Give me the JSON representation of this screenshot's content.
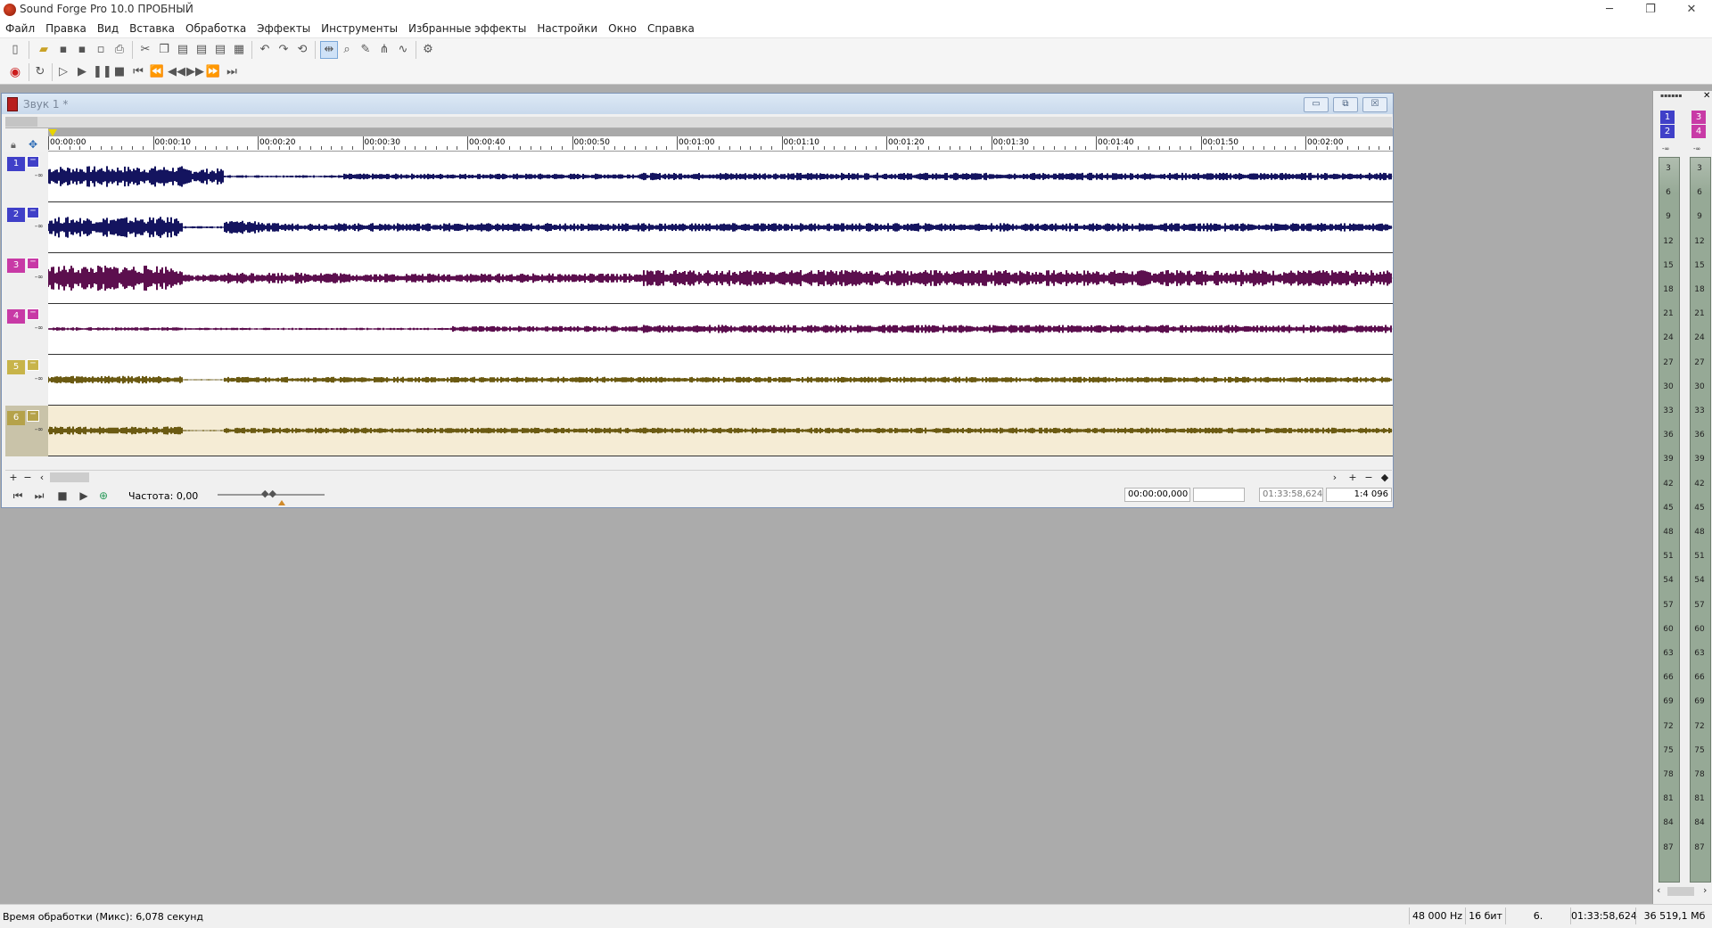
{
  "app": {
    "title": "Sound Forge Pro 10.0 ПРОБНЫЙ"
  },
  "window_controls": {
    "minimize": "─",
    "maximize": "❐",
    "close": "✕"
  },
  "menu": [
    "Файл",
    "Правка",
    "Вид",
    "Вставка",
    "Обработка",
    "Эффекты",
    "Инструменты",
    "Избранные эффекты",
    "Настройки",
    "Окно",
    "Справка"
  ],
  "document": {
    "title": "Звук 1 *",
    "controls": {
      "minimize": "▭",
      "restore": "⧉",
      "close": "☒"
    }
  },
  "timeline": {
    "labels": [
      "00:00:00",
      "00:00:10",
      "00:00:20",
      "00:00:30",
      "00:00:40",
      "00:00:50",
      "00:01:00",
      "00:01:10",
      "00:01:20",
      "00:01:30",
      "00:01:40",
      "00:01:50",
      "00:02:00"
    ]
  },
  "channels": [
    {
      "number": "1",
      "inf": "-∞",
      "tag_color": "#4040c8",
      "wave_color": "#14145f"
    },
    {
      "number": "2",
      "inf": "-∞",
      "tag_color": "#4040c8",
      "wave_color": "#14145f"
    },
    {
      "number": "3",
      "inf": "-∞",
      "tag_color": "#c83aa6",
      "wave_color": "#5c0f4e"
    },
    {
      "number": "4",
      "inf": "-∞",
      "tag_color": "#c83aa6",
      "wave_color": "#5c0f4e"
    },
    {
      "number": "5",
      "inf": "-∞",
      "tag_color": "#c8b44a",
      "wave_color": "#6b5a12"
    },
    {
      "number": "6",
      "inf": "-∞",
      "tag_color": "#b5a24a",
      "wave_color": "#6b5a12"
    }
  ],
  "transport": {
    "rate_label": "Частота: 0,00",
    "sel_start": "00:00:00,000",
    "sel_length": "",
    "file_length": "01:33:58,624",
    "zoom": "1:4 096"
  },
  "meters": {
    "tags": [
      "1",
      "2",
      "3",
      "4"
    ],
    "inf": "-∞",
    "scale": [
      "3",
      "6",
      "9",
      "12",
      "15",
      "18",
      "21",
      "24",
      "27",
      "30",
      "33",
      "36",
      "39",
      "42",
      "45",
      "48",
      "51",
      "54",
      "57",
      "60",
      "63",
      "66",
      "69",
      "72",
      "75",
      "78",
      "81",
      "84",
      "87"
    ]
  },
  "status": {
    "processing_time": "Время обработки (Микс): 6,078 секунд",
    "sample_rate": "48 000 Hz",
    "bit_depth": "16 бит",
    "channels": "6.",
    "length": "01:33:58,624",
    "size": "36 519,1 Мб"
  },
  "colors": {
    "accent": "#7d93b6",
    "record": "#cc1d1d"
  }
}
